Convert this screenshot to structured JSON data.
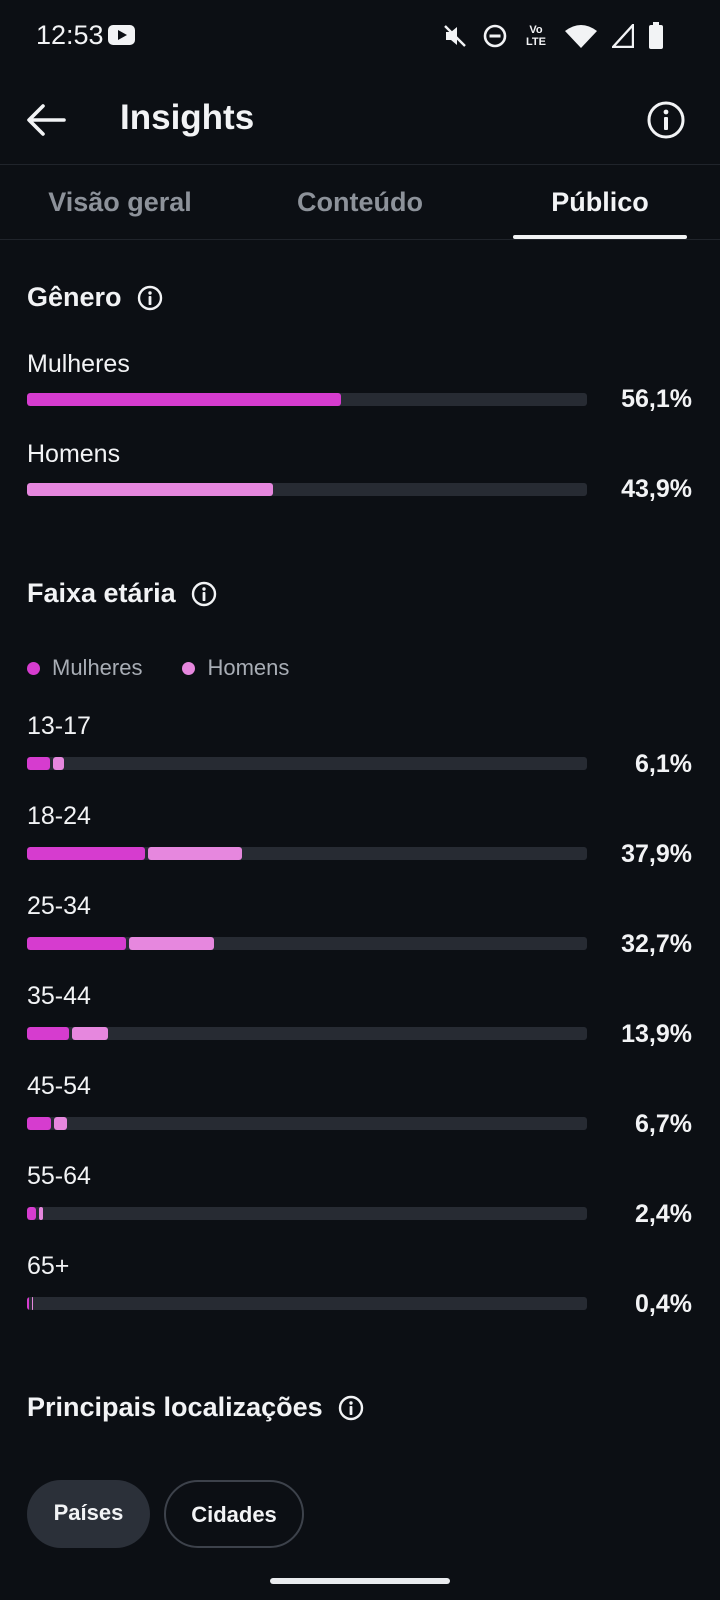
{
  "status_bar": {
    "time": "12:53",
    "volte_label": "Vo LTE",
    "icons": [
      "youtube-icon",
      "mute-icon",
      "do-not-disturb-icon",
      "volte-icon",
      "wifi-icon",
      "signal-icon",
      "battery-icon"
    ]
  },
  "header": {
    "title": "Insights"
  },
  "tabs": [
    {
      "label": "Visão geral",
      "active": false
    },
    {
      "label": "Conteúdo",
      "active": false
    },
    {
      "label": "Público",
      "active": true
    }
  ],
  "gender": {
    "title": "Gênero",
    "rows": [
      {
        "label": "Mulheres",
        "value": "56,1%",
        "fraction": 0.561
      },
      {
        "label": "Homens",
        "value": "43,9%",
        "fraction": 0.439
      }
    ]
  },
  "age": {
    "title": "Faixa etária",
    "legend": {
      "women": "Mulheres",
      "men": "Homens"
    },
    "rows": [
      {
        "label": "13-17",
        "value": "6,1%",
        "women": 0.041,
        "men": 0.02
      },
      {
        "label": "18-24",
        "value": "37,9%",
        "women": 0.211,
        "men": 0.168
      },
      {
        "label": "25-34",
        "value": "32,7%",
        "women": 0.176,
        "men": 0.151
      },
      {
        "label": "35-44",
        "value": "13,9%",
        "women": 0.075,
        "men": 0.064
      },
      {
        "label": "45-54",
        "value": "6,7%",
        "women": 0.043,
        "men": 0.024
      },
      {
        "label": "55-64",
        "value": "2,4%",
        "women": 0.016,
        "men": 0.008
      },
      {
        "label": "65+",
        "value": "0,4%",
        "women": 0.003,
        "men": 0.001
      }
    ]
  },
  "locations": {
    "title": "Principais localizações",
    "chips": [
      {
        "label": "Países",
        "active": true
      },
      {
        "label": "Cidades",
        "active": false
      }
    ]
  },
  "colors": {
    "women": "#d63ccf",
    "men": "#e687de",
    "track": "#272b33",
    "background": "#0c0f14"
  }
}
